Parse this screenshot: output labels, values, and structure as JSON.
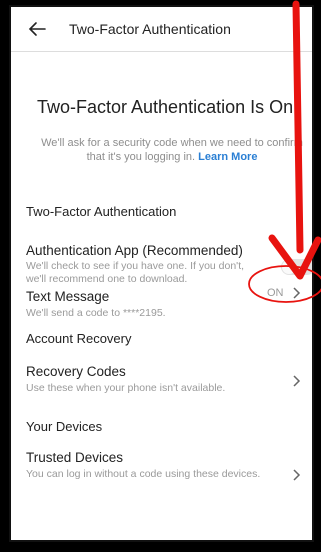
{
  "header": {
    "title": "Two-Factor Authentication"
  },
  "hero": {
    "title": "Two-Factor Authentication Is On",
    "desc": "We'll ask for a security code when we need to confirm that it's you logging in.",
    "learn_more": "Learn More"
  },
  "sections": {
    "two_factor": "Two-Factor Authentication",
    "account_recovery": "Account Recovery",
    "your_devices": "Your Devices"
  },
  "rows": {
    "auth_app": {
      "title": "Authentication App (Recommended)",
      "desc": "We'll check to see if you have one. If you don't, we'll recommend one to download."
    },
    "text_message": {
      "title": "Text Message",
      "desc": "We'll send a code to ****2195.",
      "status": "ON"
    },
    "recovery_codes": {
      "title": "Recovery Codes",
      "desc": "Use these when your phone isn't available."
    },
    "trusted_devices": {
      "title": "Trusted Devices",
      "desc": "You can log in without a code using these devices."
    }
  },
  "colors": {
    "annotation": "#e8130f",
    "link": "#2a7fd4"
  }
}
